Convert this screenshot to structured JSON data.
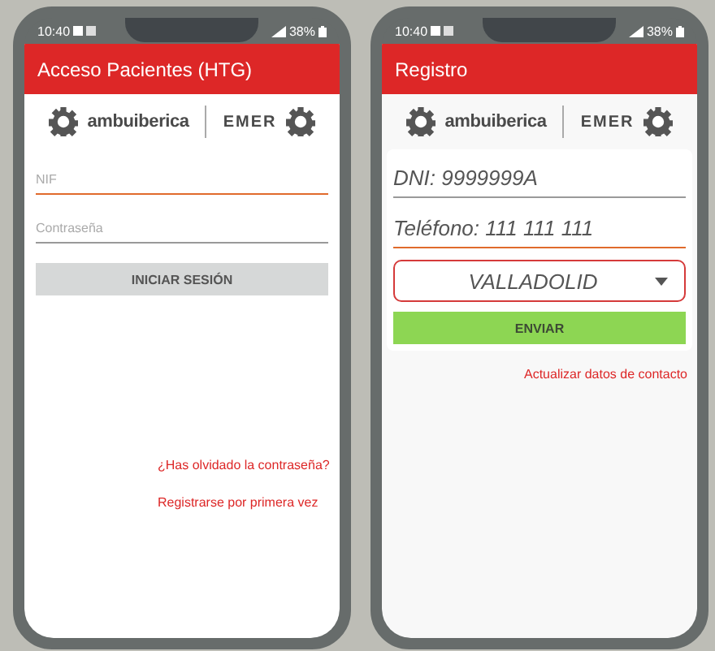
{
  "screens": [
    {
      "kind": "login",
      "status_bar": {
        "time": "10:40",
        "battery": "38%"
      },
      "title": "Acceso Pacientes (HTG)",
      "logos": {
        "left": "ambuiberica",
        "right": "EMER"
      },
      "fields": [
        {
          "kind": "input",
          "placeholder": "NIF",
          "focused": true
        },
        {
          "kind": "input",
          "placeholder": "Contraseña",
          "focused": false
        }
      ],
      "button": {
        "label": "INICIAR SESIÓN",
        "kind": "neutral"
      },
      "links": [
        "¿Has olvidado la contraseña?",
        "Registrarse por primera vez"
      ]
    },
    {
      "kind": "register",
      "status_bar": {
        "time": "10:40",
        "battery": "38%"
      },
      "title": "Registro",
      "logos": {
        "left": "ambuiberica",
        "right": "EMER"
      },
      "fields": [
        {
          "kind": "input",
          "value": "DNI: 9999999A",
          "focused": false
        },
        {
          "kind": "input",
          "value": "Teléfono: 111 111 111",
          "focused": true
        },
        {
          "kind": "select",
          "value": "VALLADOLID"
        }
      ],
      "button": {
        "label": "ENVIAR",
        "kind": "primary"
      },
      "links": [
        "Actualizar datos de contacto"
      ]
    }
  ]
}
